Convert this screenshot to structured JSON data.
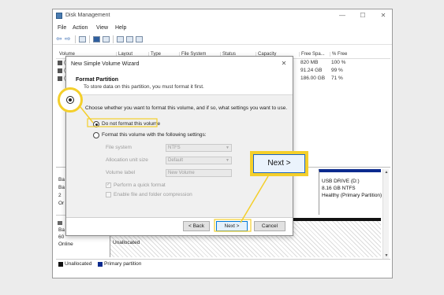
{
  "window": {
    "title": "Disk Management",
    "controls": {
      "minimize": "—",
      "maximize": "☐",
      "close": "✕"
    }
  },
  "menu": [
    "File",
    "Action",
    "View",
    "Help"
  ],
  "volume_table": {
    "columns": [
      "Volume",
      "Layout",
      "Type",
      "File System",
      "Status",
      "Capacity",
      "Free Spa...",
      "% Free"
    ],
    "rows": [
      {
        "volume": "(",
        "free": "820 MB",
        "pct": "100 %"
      },
      {
        "volume": "(",
        "free": "91.24 GB",
        "pct": "99 %"
      },
      {
        "volume": "(",
        "free": "186.00 GB",
        "pct": "71 %"
      }
    ]
  },
  "disks": {
    "disk1_labels": [
      "Ba",
      "Ba",
      "2",
      "Or"
    ],
    "disk2_labels": [
      "Ba",
      "60",
      "Online"
    ],
    "usb": {
      "line1": "USB DRIVE (D:)",
      "line2": "8.16 GB NTFS",
      "line3": "Healthy (Primary Partition)"
    },
    "unallocated_label": "Unallocated"
  },
  "legend": [
    {
      "label": "Unallocated",
      "color": "#111111"
    },
    {
      "label": "Primary partition",
      "color": "#0b2a8e"
    }
  ],
  "wizard": {
    "title": "New Simple Volume Wizard",
    "close": "✕",
    "heading": "Format Partition",
    "description": "To store data on this partition, you must format it first.",
    "instruction": "Choose whether you want to format this volume, and if so, what settings you want to use.",
    "option_no_format": "Do not format this volume",
    "option_format": "Format this volume with the following settings:",
    "selected_option": "Do not format this volume",
    "fields": {
      "file_system": {
        "label": "File system",
        "value": "NTFS"
      },
      "allocation_unit_size": {
        "label": "Allocation unit size",
        "value": "Default"
      },
      "volume_label": {
        "label": "Volume label",
        "value": "New Volume"
      }
    },
    "quick_format": {
      "label": "Perform a quick format",
      "checked": true
    },
    "compression": {
      "label": "Enable file and folder compression",
      "checked": false
    },
    "buttons": {
      "back": "< Back",
      "next": "Next >",
      "cancel": "Cancel"
    }
  },
  "callouts": {
    "next_label": "Next >",
    "accent_color": "#f4cf2b"
  }
}
